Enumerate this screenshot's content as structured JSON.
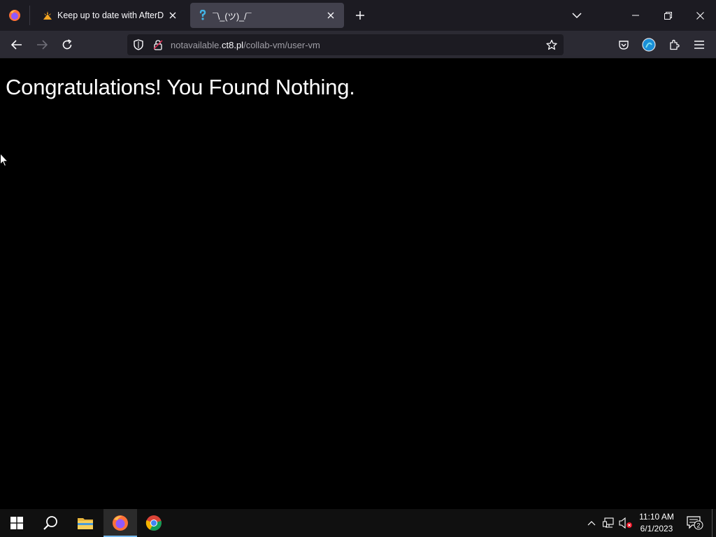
{
  "browser": {
    "tabs": [
      {
        "title": "Keep up to date with AfterDawn",
        "favicon": "afterdawn-icon",
        "active": false
      },
      {
        "title": "¯\\_(ツ)_/¯",
        "favicon": "shrug-emoji-icon",
        "active": true
      }
    ],
    "url": {
      "prefix": "notavailable.",
      "domain": "ct8.pl",
      "path": "/collab-vm/user-vm"
    }
  },
  "page": {
    "heading": "Congratulations! You Found Nothing."
  },
  "taskbar": {
    "apps": [
      "start",
      "search",
      "file-explorer",
      "firefox",
      "chrome"
    ],
    "clock": {
      "time": "11:10 AM",
      "date": "6/1/2023"
    },
    "notification_count": "2"
  },
  "colors": {
    "tabstrip": "#1c1b22",
    "navbar": "#2b2a33",
    "active_tab": "#42414d",
    "page_background": "#000000",
    "taskbar": "#101010",
    "taskbar_active_indicator": "#76b9ed"
  }
}
